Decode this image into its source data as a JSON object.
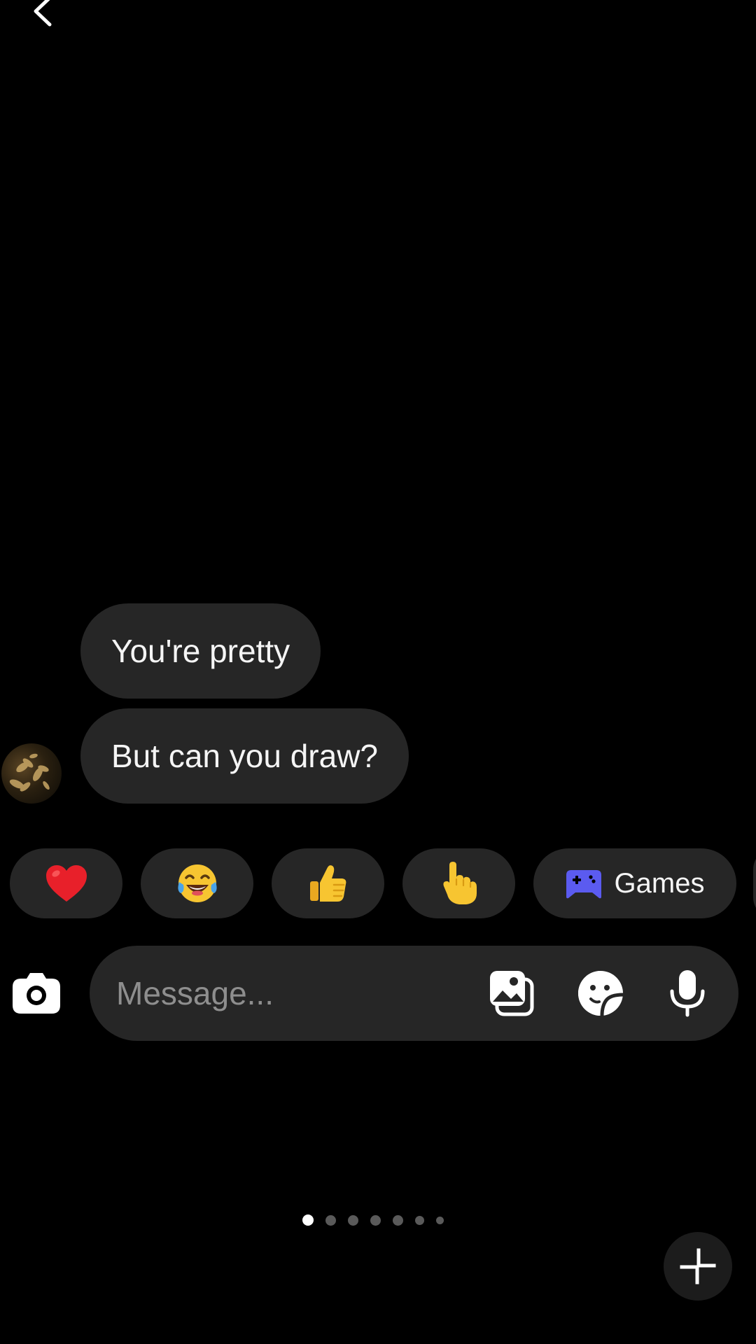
{
  "colors": {
    "background": "#000000",
    "bubble": "#262626",
    "text": "#f5f5f5",
    "placeholder": "#8e8e8e",
    "games_icon": "#5b5bf0",
    "heart": "#e8202a"
  },
  "header": {
    "back_icon": "chevron-left-icon"
  },
  "messages": [
    {
      "text": "You're pretty"
    },
    {
      "text": "But can you draw?"
    }
  ],
  "reactions": [
    {
      "emoji": "❤️",
      "icon": "heart-emoji"
    },
    {
      "emoji": "😂",
      "icon": "tears-of-joy-emoji"
    },
    {
      "emoji": "👍",
      "icon": "thumbs-up-emoji"
    },
    {
      "emoji": "👆",
      "icon": "pointing-up-emoji"
    }
  ],
  "games": {
    "label": "Games",
    "icon": "gamepad-icon"
  },
  "composer": {
    "placeholder": "Message...",
    "camera_icon": "camera-icon",
    "gallery_icon": "gallery-icon",
    "sticker_icon": "sticker-icon",
    "mic_icon": "microphone-icon"
  },
  "pagination": {
    "total": 7,
    "active": 1
  },
  "minimize_icon": "minimize-icon"
}
